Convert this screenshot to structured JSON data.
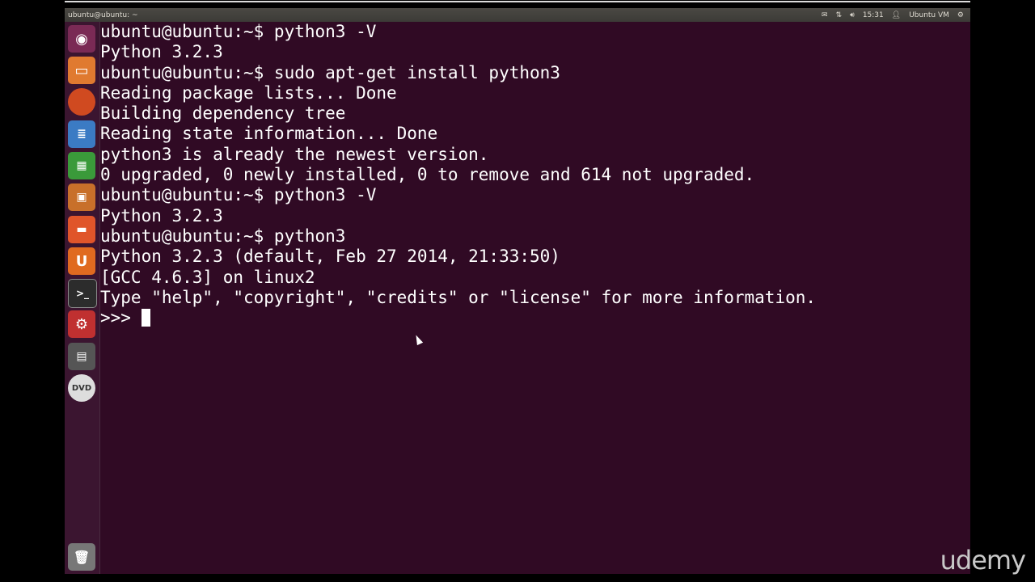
{
  "panel": {
    "title": "ubuntu@ubuntu: ~",
    "time": "15:31",
    "user": "Ubuntu VM"
  },
  "terminal": {
    "lines": [
      "ubuntu@ubuntu:~$ python3 -V",
      "Python 3.2.3",
      "ubuntu@ubuntu:~$ sudo apt-get install python3",
      "Reading package lists... Done",
      "Building dependency tree",
      "Reading state information... Done",
      "python3 is already the newest version.",
      "0 upgraded, 0 newly installed, 0 to remove and 614 not upgraded.",
      "ubuntu@ubuntu:~$ python3 -V",
      "Python 3.2.3",
      "ubuntu@ubuntu:~$ python3",
      "Python 3.2.3 (default, Feb 27 2014, 21:33:50)",
      "[GCC 4.6.3] on linux2",
      "Type \"help\", \"copyright\", \"credits\" or \"license\" for more information."
    ],
    "prompt": ">>> "
  },
  "watermark": "udemy"
}
